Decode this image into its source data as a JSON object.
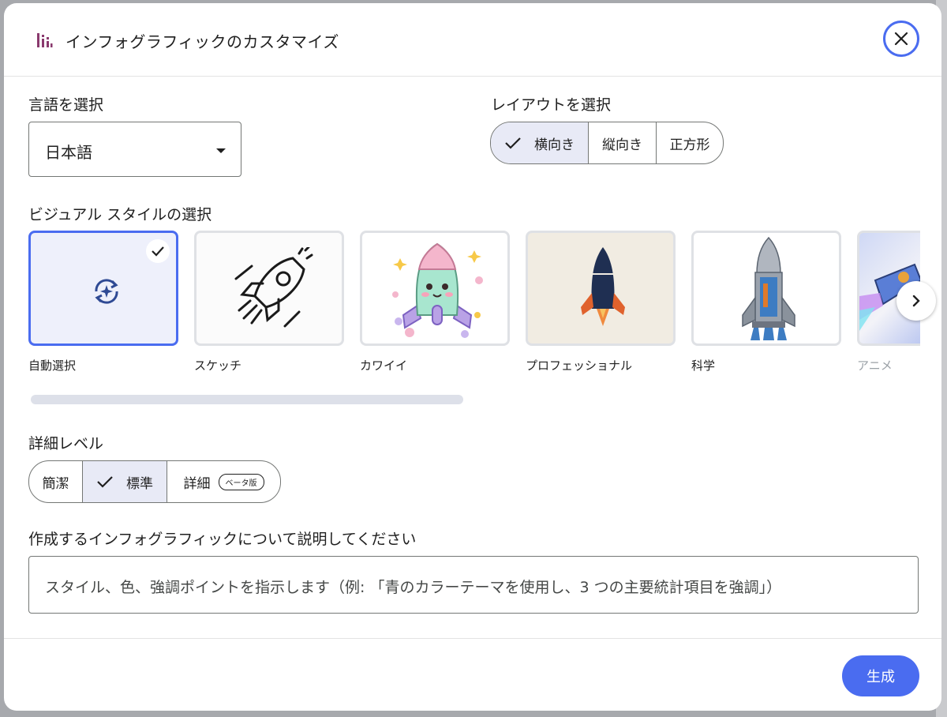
{
  "dialog": {
    "title": "インフォグラフィックのカスタマイズ",
    "icons": {
      "logo": "bar-chart-icon",
      "close": "close-icon"
    }
  },
  "language": {
    "label": "言語を選択",
    "selected": "日本語"
  },
  "layout": {
    "label": "レイアウトを選択",
    "options": [
      "横向き",
      "縦向き",
      "正方形"
    ],
    "selected_index": 0
  },
  "visual_style": {
    "label": "ビジュアル スタイルの選択",
    "cards": [
      {
        "label": "自動選択",
        "icon": "auto-sparkle-icon",
        "selected": true
      },
      {
        "label": "スケッチ",
        "icon": "sketch-rocket",
        "selected": false
      },
      {
        "label": "カワイイ",
        "icon": "kawaii-rocket",
        "selected": false
      },
      {
        "label": "プロフェッショナル",
        "icon": "professional-rocket",
        "selected": false
      },
      {
        "label": "科学",
        "icon": "science-rocket",
        "selected": false
      },
      {
        "label": "アニメ",
        "icon": "anime-rocket",
        "selected": false
      }
    ]
  },
  "detail": {
    "label": "詳細レベル",
    "options": [
      "簡潔",
      "標準",
      "詳細"
    ],
    "selected_index": 1,
    "beta_badge": "ベータ版"
  },
  "description": {
    "label": "作成するインフォグラフィックについて説明してください",
    "placeholder": "スタイル、色、強調ポイントを指示します（例: 「青のカラーテーマを使用し、3 つの主要統計項目を強調」）"
  },
  "actions": {
    "generate": "生成"
  },
  "colors": {
    "accent": "#4a6cf0",
    "selected_bg": "#e8eaf6",
    "logo": "#8a3a6e"
  }
}
